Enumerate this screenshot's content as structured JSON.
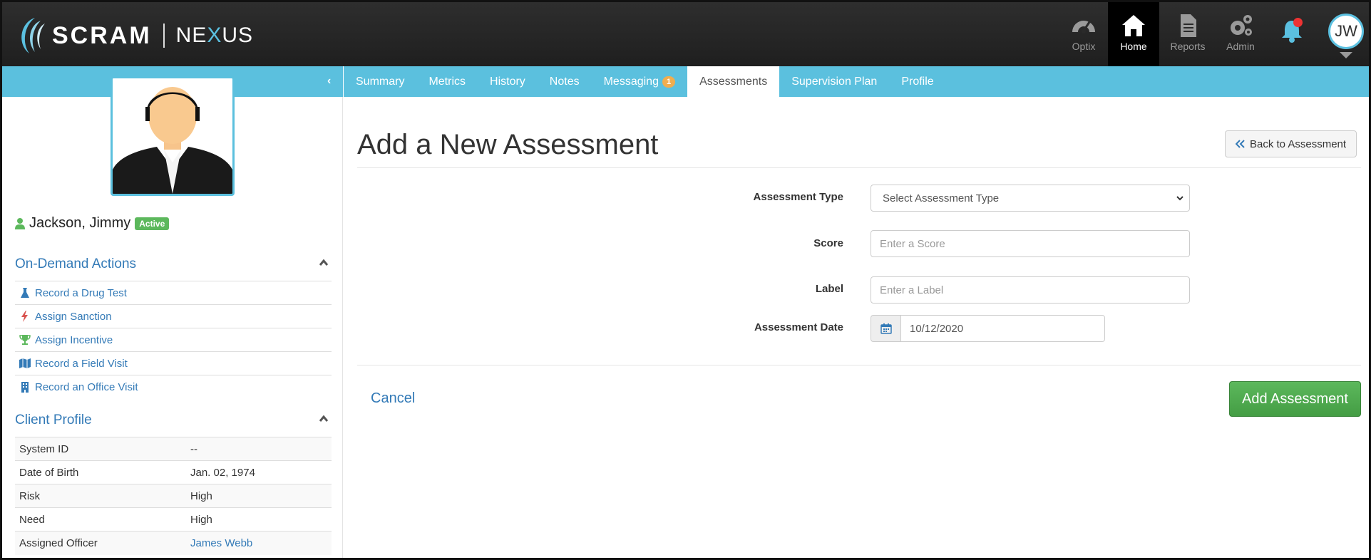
{
  "app": {
    "brand": "SCRAM",
    "product_pre": "NE",
    "product_x": "X",
    "product_post": "US"
  },
  "topnav": {
    "optix": "Optix",
    "home": "Home",
    "reports": "Reports",
    "admin": "Admin",
    "user_initials": "JW"
  },
  "client": {
    "name": "Jackson, Jimmy",
    "status": "Active"
  },
  "on_demand": {
    "title": "On-Demand Actions",
    "items": [
      {
        "label": "Record a Drug Test",
        "icon": "flask-icon",
        "color": "#337ab7"
      },
      {
        "label": "Assign Sanction",
        "icon": "bolt-icon",
        "color": "#d9534f"
      },
      {
        "label": "Assign Incentive",
        "icon": "trophy-icon",
        "color": "#5cb85c"
      },
      {
        "label": "Record a Field Visit",
        "icon": "map-icon",
        "color": "#337ab7"
      },
      {
        "label": "Record an Office Visit",
        "icon": "building-icon",
        "color": "#337ab7"
      }
    ]
  },
  "client_profile": {
    "title": "Client Profile",
    "rows": [
      {
        "key": "System ID",
        "value": "--"
      },
      {
        "key": "Date of Birth",
        "value": "Jan. 02, 1974"
      },
      {
        "key": "Risk",
        "value": "High"
      },
      {
        "key": "Need",
        "value": "High"
      },
      {
        "key": "Assigned Officer",
        "value": "James Webb"
      }
    ]
  },
  "tabs": {
    "summary": "Summary",
    "metrics": "Metrics",
    "history": "History",
    "notes": "Notes",
    "messaging": "Messaging",
    "messaging_count": "1",
    "assessments": "Assessments",
    "supervision_plan": "Supervision Plan",
    "profile": "Profile"
  },
  "form": {
    "page_title": "Add a New Assessment",
    "back_label": "Back to Assessment",
    "type_label": "Assessment Type",
    "type_selected": "Select Assessment Type",
    "score_label": "Score",
    "score_placeholder": "Enter a Score",
    "label_label": "Label",
    "label_placeholder": "Enter a Label",
    "date_label": "Assessment Date",
    "date_value": "10/12/2020",
    "cancel_label": "Cancel",
    "submit_label": "Add Assessment"
  },
  "colors": {
    "accent": "#5bc0de",
    "link": "#337ab7",
    "success": "#5cb85c",
    "badge": "#f0ad4e",
    "alert": "#e33333"
  }
}
